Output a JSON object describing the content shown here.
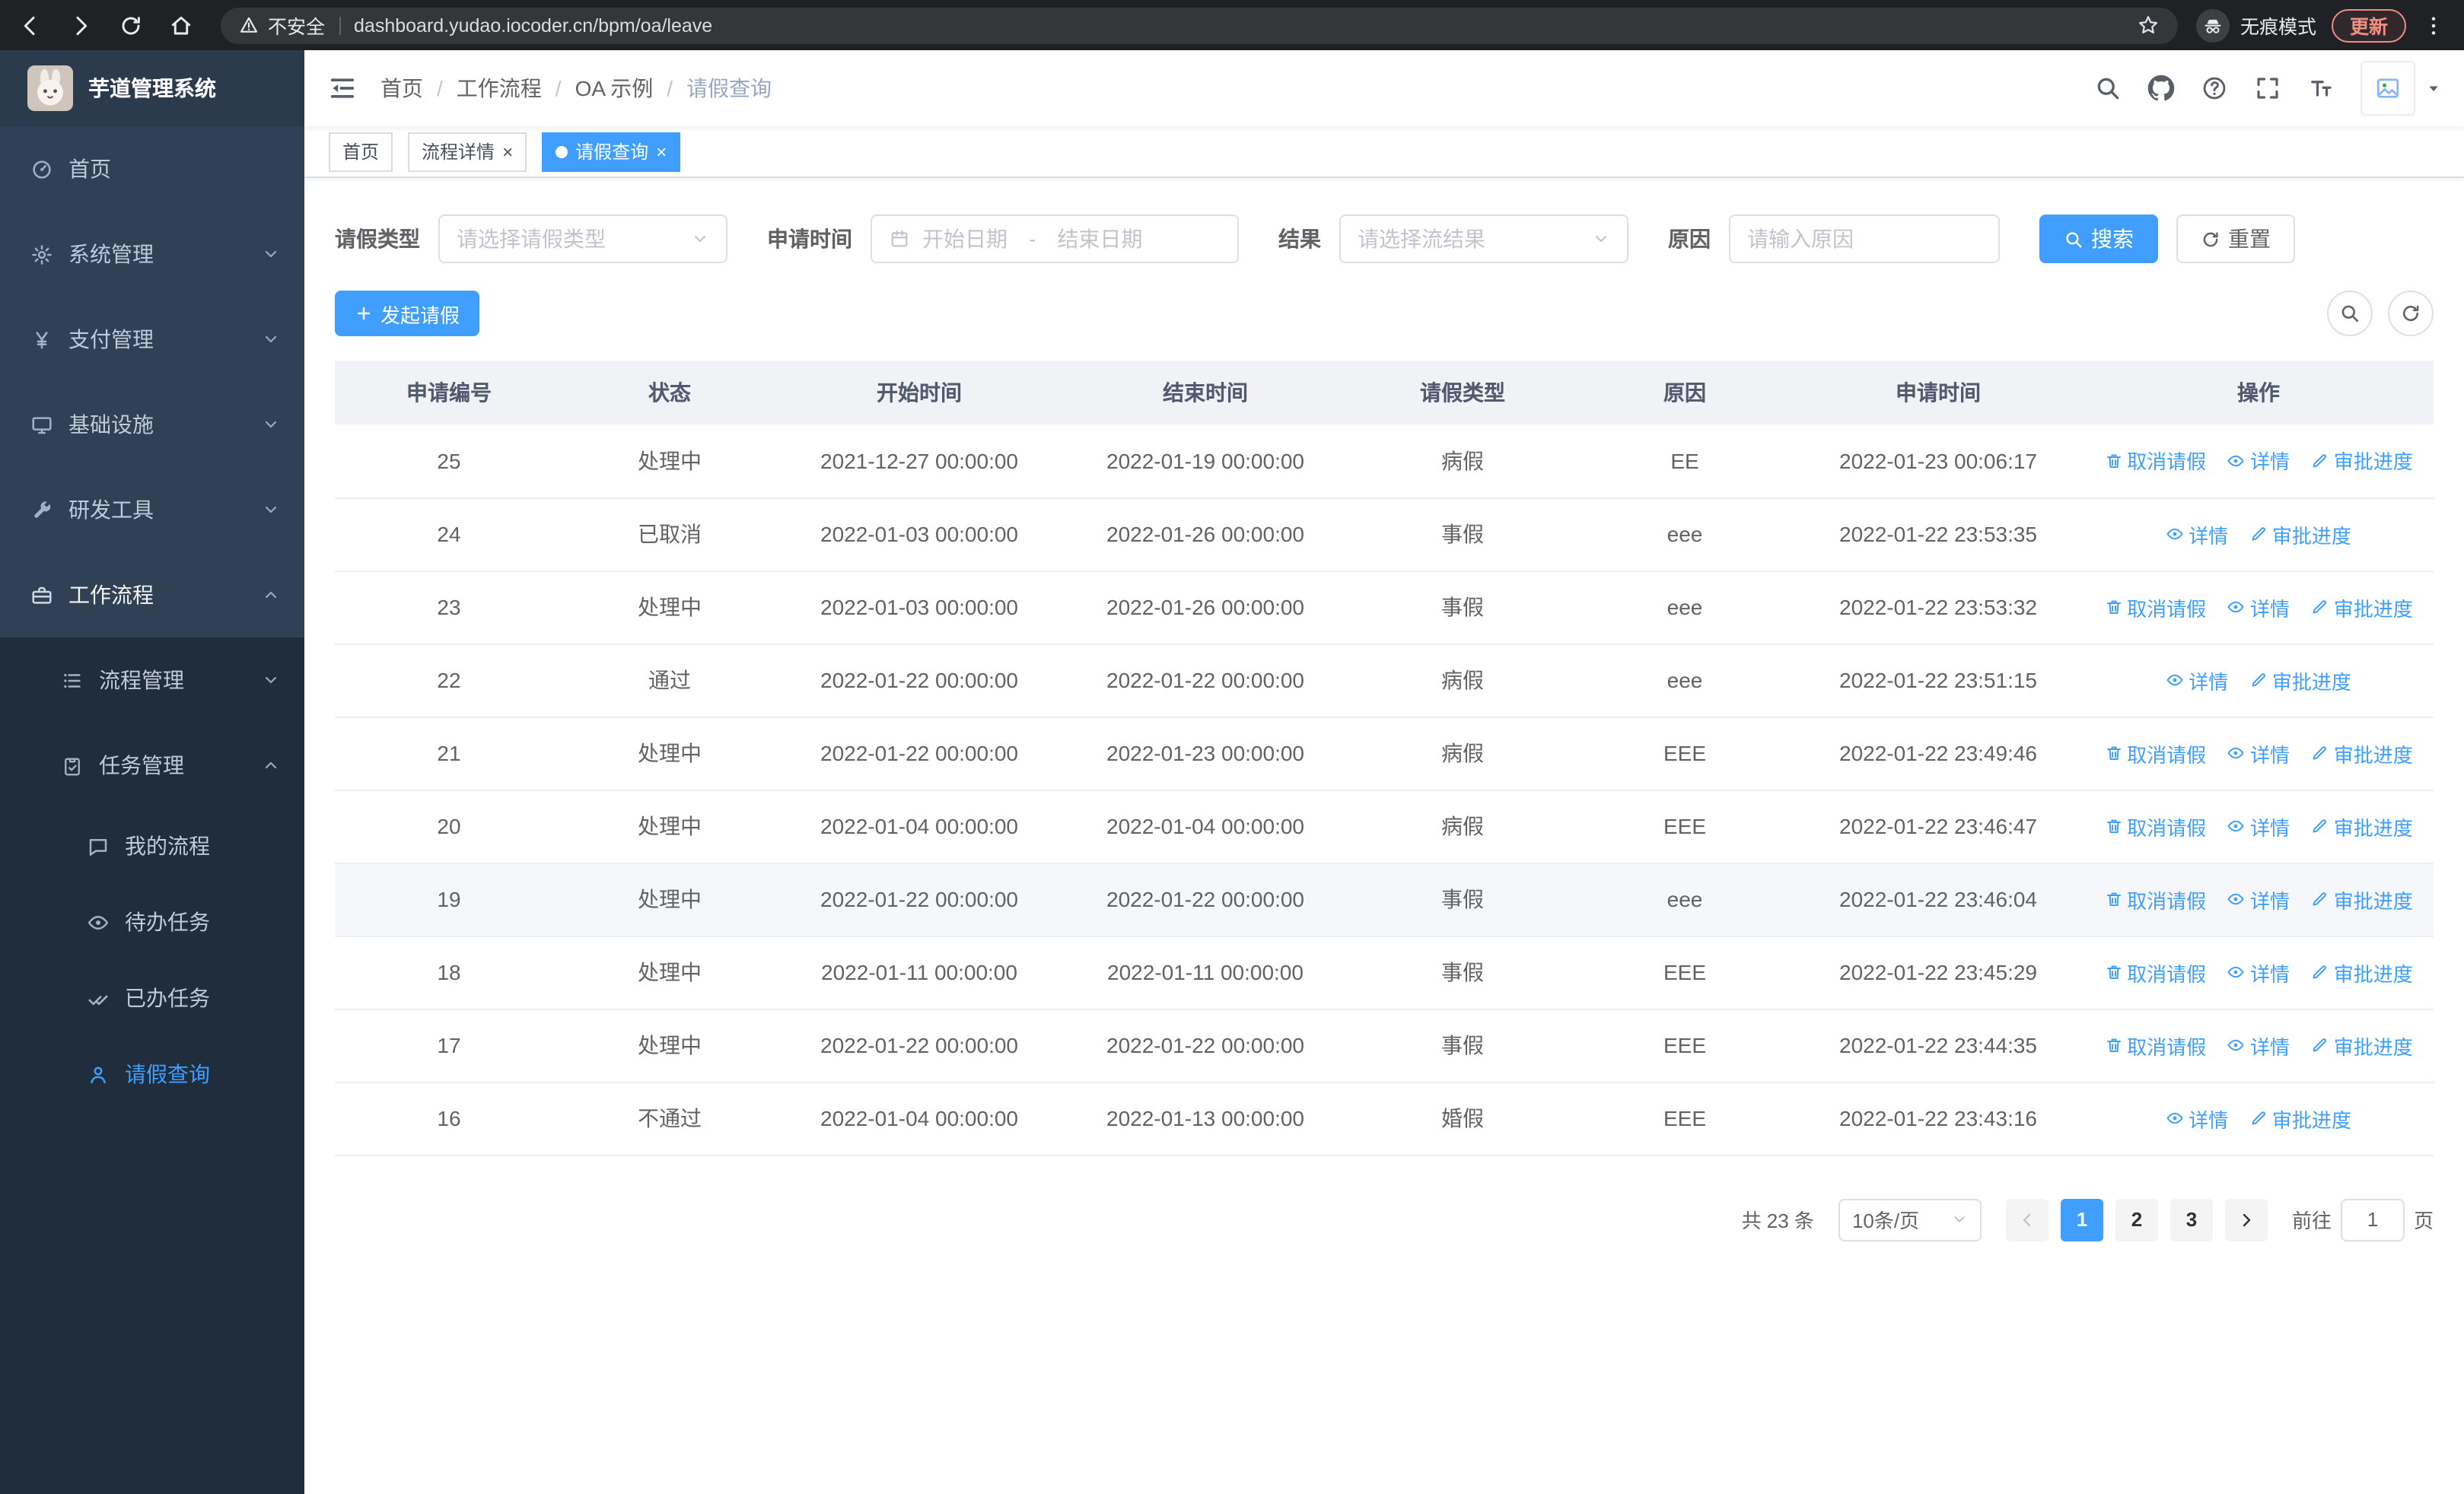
{
  "browser": {
    "security_label": "不安全",
    "url": "dashboard.yudao.iocoder.cn/bpm/oa/leave",
    "incognito_label": "无痕模式",
    "update_label": "更新"
  },
  "sidebar": {
    "logo_title": "芋道管理系统",
    "items": {
      "home": "首页",
      "system": "系统管理",
      "payment": "支付管理",
      "infra": "基础设施",
      "dev_tools": "研发工具",
      "workflow": "工作流程",
      "process_mgmt": "流程管理",
      "task_mgmt": "任务管理",
      "my_process": "我的流程",
      "todo_tasks": "待办任务",
      "done_tasks": "已办任务",
      "leave_query": "请假查询"
    }
  },
  "header": {
    "breadcrumb": [
      "首页",
      "工作流程",
      "OA 示例",
      "请假查询"
    ],
    "breadcrumb_separator": "/"
  },
  "tabs": [
    {
      "label": "首页"
    },
    {
      "label": "流程详情"
    },
    {
      "label": "请假查询"
    }
  ],
  "tab_close_glyph": "×",
  "filters": {
    "leave_type_label": "请假类型",
    "leave_type_placeholder": "请选择请假类型",
    "apply_time_label": "申请时间",
    "date_start_placeholder": "开始日期",
    "date_separator": "-",
    "date_end_placeholder": "结束日期",
    "result_label": "结果",
    "result_placeholder": "请选择流结果",
    "reason_label": "原因",
    "reason_placeholder": "请输入原因",
    "search_label": "搜索",
    "reset_label": "重置"
  },
  "toolbar": {
    "create_label": "发起请假"
  },
  "table": {
    "columns": [
      "申请编号",
      "状态",
      "开始时间",
      "结束时间",
      "请假类型",
      "原因",
      "申请时间",
      "操作"
    ],
    "ops": {
      "cancel": "取消请假",
      "detail": "详情",
      "progress": "审批进度"
    },
    "rows": [
      {
        "id": "25",
        "status": "处理中",
        "start": "2021-12-27 00:00:00",
        "end": "2022-01-19 00:00:00",
        "type": "病假",
        "reason": "EE",
        "applied": "2022-01-23 00:06:17",
        "cancel": true,
        "hover": false
      },
      {
        "id": "24",
        "status": "已取消",
        "start": "2022-01-03 00:00:00",
        "end": "2022-01-26 00:00:00",
        "type": "事假",
        "reason": "eee",
        "applied": "2022-01-22 23:53:35",
        "cancel": false,
        "hover": false
      },
      {
        "id": "23",
        "status": "处理中",
        "start": "2022-01-03 00:00:00",
        "end": "2022-01-26 00:00:00",
        "type": "事假",
        "reason": "eee",
        "applied": "2022-01-22 23:53:32",
        "cancel": true,
        "hover": false
      },
      {
        "id": "22",
        "status": "通过",
        "start": "2022-01-22 00:00:00",
        "end": "2022-01-22 00:00:00",
        "type": "病假",
        "reason": "eee",
        "applied": "2022-01-22 23:51:15",
        "cancel": false,
        "hover": false
      },
      {
        "id": "21",
        "status": "处理中",
        "start": "2022-01-22 00:00:00",
        "end": "2022-01-23 00:00:00",
        "type": "病假",
        "reason": "EEE",
        "applied": "2022-01-22 23:49:46",
        "cancel": true,
        "hover": false
      },
      {
        "id": "20",
        "status": "处理中",
        "start": "2022-01-04 00:00:00",
        "end": "2022-01-04 00:00:00",
        "type": "病假",
        "reason": "EEE",
        "applied": "2022-01-22 23:46:47",
        "cancel": true,
        "hover": false
      },
      {
        "id": "19",
        "status": "处理中",
        "start": "2022-01-22 00:00:00",
        "end": "2022-01-22 00:00:00",
        "type": "事假",
        "reason": "eee",
        "applied": "2022-01-22 23:46:04",
        "cancel": true,
        "hover": true
      },
      {
        "id": "18",
        "status": "处理中",
        "start": "2022-01-11 00:00:00",
        "end": "2022-01-11 00:00:00",
        "type": "事假",
        "reason": "EEE",
        "applied": "2022-01-22 23:45:29",
        "cancel": true,
        "hover": false
      },
      {
        "id": "17",
        "status": "处理中",
        "start": "2022-01-22 00:00:00",
        "end": "2022-01-22 00:00:00",
        "type": "事假",
        "reason": "EEE",
        "applied": "2022-01-22 23:44:35",
        "cancel": true,
        "hover": false
      },
      {
        "id": "16",
        "status": "不通过",
        "start": "2022-01-04 00:00:00",
        "end": "2022-01-13 00:00:00",
        "type": "婚假",
        "reason": "EEE",
        "applied": "2022-01-22 23:43:16",
        "cancel": false,
        "hover": false
      }
    ]
  },
  "pagination": {
    "total_label": "共 23 条",
    "page_size": "10条/页",
    "pages": [
      "1",
      "2",
      "3"
    ],
    "goto_label": "前往",
    "goto_value": "1",
    "page_unit": "页"
  },
  "colors": {
    "primary": "#409eff",
    "sidebar_bg": "#304156",
    "submenu_bg": "#1f2d3d",
    "active_text": "#409eff"
  }
}
